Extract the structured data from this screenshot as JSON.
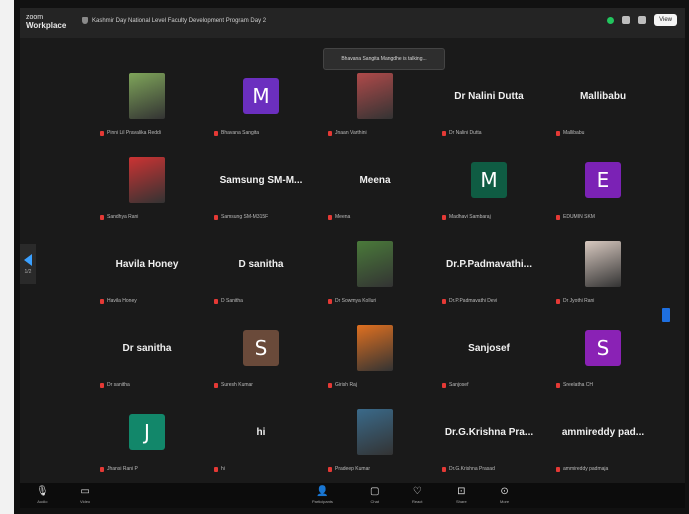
{
  "app": {
    "brand_line1": "zoom",
    "brand_line2": "Workplace",
    "meeting_title": "Kashmir Day National Level Faculty Development Program Day 2",
    "view_button": "View",
    "tooltip": "Bhavana Sangita Mangdhe is talking...",
    "side_count": "1/2"
  },
  "tiles": [
    {
      "kind": "photo",
      "color": "#7fa55a",
      "caption": "Pinni Lil Pravalika Reddi"
    },
    {
      "kind": "letter",
      "letter": "M",
      "color": "#6b2fbf",
      "caption": "Bhavana Sangita"
    },
    {
      "kind": "photo",
      "color": "#b04a4a",
      "caption": "Jnaan Varthini"
    },
    {
      "kind": "name",
      "name": "Dr Nalini Dutta",
      "caption": "Dr Nalini Dutta"
    },
    {
      "kind": "name",
      "name": "Mallibabu",
      "caption": "Mallibabu"
    },
    {
      "kind": "photo",
      "color": "#cc3333",
      "caption": "Sandhya Rani"
    },
    {
      "kind": "name",
      "name": "Samsung  SM-M...",
      "caption": "Samsung SM-M315F"
    },
    {
      "kind": "name",
      "name": "Meena",
      "caption": "Meena"
    },
    {
      "kind": "letter",
      "letter": "M",
      "color": "#0f5c43",
      "caption": "Madhavi Sambaraj"
    },
    {
      "kind": "letter",
      "letter": "E",
      "color": "#7b22b5",
      "caption": "EDUMIN SKM"
    },
    {
      "kind": "name",
      "name": "Havila Honey",
      "caption": "Havila Honey"
    },
    {
      "kind": "name",
      "name": "D sanitha",
      "caption": "D Sanitha"
    },
    {
      "kind": "photo",
      "color": "#4a7a3a",
      "caption": "Dr Sowmya Kolluri"
    },
    {
      "kind": "name",
      "name": "Dr.P.Padmavathi...",
      "caption": "Dr.P.Padmavathi Devi"
    },
    {
      "kind": "photo",
      "color": "#d8c9c0",
      "caption": "Dr Jyothi Rani"
    },
    {
      "kind": "name",
      "name": "Dr sanitha",
      "caption": "Dr sanitha"
    },
    {
      "kind": "letter",
      "letter": "S",
      "color": "#6a4a3a",
      "caption": "Suresh Kumar"
    },
    {
      "kind": "photo",
      "color": "#e07020",
      "caption": "Girish Raj"
    },
    {
      "kind": "name",
      "name": "Sanjosef",
      "caption": "Sanjosef"
    },
    {
      "kind": "letter",
      "letter": "S",
      "color": "#8a22b5",
      "caption": "Sreelatha CH"
    },
    {
      "kind": "letter",
      "letter": "J",
      "color": "#12876a",
      "caption": "Jhansi Rani P"
    },
    {
      "kind": "name",
      "name": "hi",
      "caption": "hi"
    },
    {
      "kind": "photo",
      "color": "#3a6a8a",
      "caption": "Pradeep Kumar"
    },
    {
      "kind": "name",
      "name": "Dr.G.Krishna  Pra...",
      "caption": "Dr.G.Krishna Prasad"
    },
    {
      "kind": "name",
      "name": "ammireddy pad...",
      "caption": "ammireddy padmaja"
    }
  ],
  "bottombar": {
    "audio": "Audio",
    "video": "Video",
    "participants": "Participants",
    "participant_count": "56",
    "chat": "Chat",
    "react": "React",
    "share": "Share",
    "more": "More"
  },
  "icons": {
    "audio": "mic-icon",
    "video": "video-icon",
    "participants": "participants-icon",
    "chat": "chat-icon",
    "react": "react-icon",
    "share": "share-icon",
    "more": "more-icon"
  }
}
